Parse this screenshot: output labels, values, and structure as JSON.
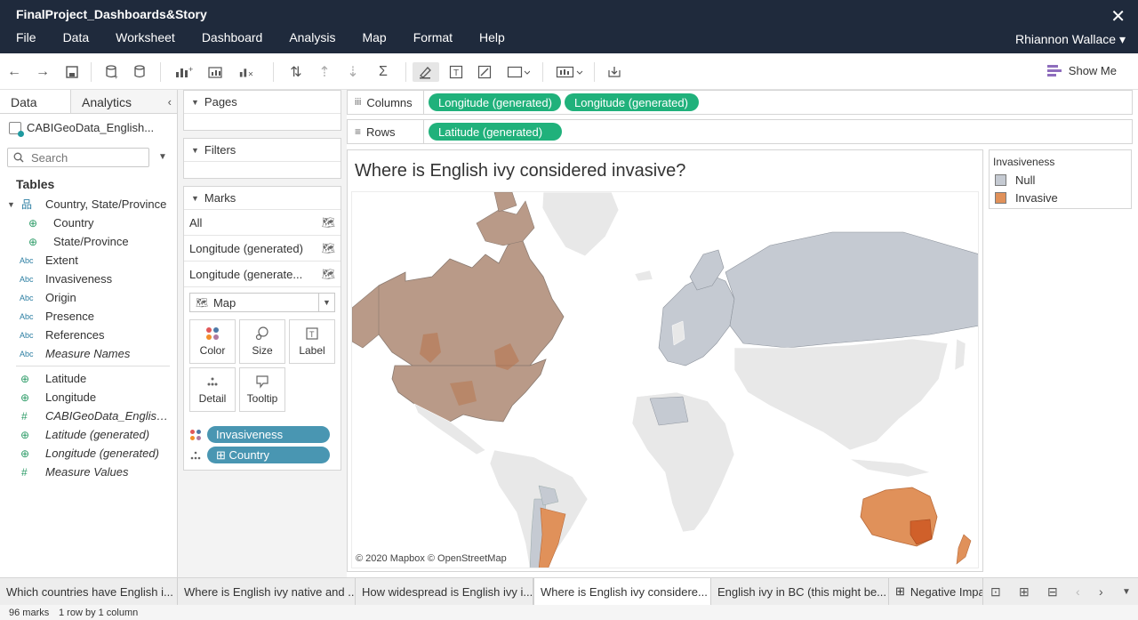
{
  "window": {
    "title": "FinalProject_Dashboards&Story",
    "close_glyph": "✕",
    "menus": [
      "File",
      "Data",
      "Worksheet",
      "Dashboard",
      "Analysis",
      "Map",
      "Format",
      "Help"
    ],
    "user": "Rhiannon Wallace ▾"
  },
  "toolbar": {
    "show_me": "Show Me",
    "icons": [
      "back-arrow-icon",
      "forward-arrow-icon",
      "save-icon",
      "new-data-source-icon",
      "pause-updates-icon",
      "new-worksheet-icon",
      "duplicate-sheet-icon",
      "clear-sheet-icon",
      "swap-rows-columns-icon",
      "sort-ascending-icon",
      "sort-descending-icon",
      "totals-icon",
      "highlight-icon",
      "labels-icon",
      "fix-axes-icon",
      "fit-icon",
      "presentation-icon",
      "share-icon"
    ]
  },
  "datapane": {
    "tab_data": "Data",
    "tab_analytics": "Analytics",
    "collapse_glyph": "‹",
    "datasource": "CABIGeoData_English...",
    "search_placeholder": "Search",
    "tables_label": "Tables",
    "hierarchy": "Country, State/Province",
    "hierarchy_children": [
      "Country",
      "State/Province"
    ],
    "dimensions": [
      "Extent",
      "Invasiveness",
      "Origin",
      "Presence",
      "References",
      "Measure Names"
    ],
    "dimension_type": "Abc",
    "measures": [
      "Latitude",
      "Longitude",
      "CABIGeoData_EnglishI...",
      "Latitude (generated)",
      "Longitude (generated)",
      "Measure Values"
    ]
  },
  "cards": {
    "pages": "Pages",
    "filters": "Filters",
    "marks": "Marks",
    "mark_rows": [
      "All",
      "Longitude (generated)",
      "Longitude (generate..."
    ],
    "mark_type": "Map",
    "mark_buttons": [
      "Color",
      "Size",
      "Label",
      "Detail",
      "Tooltip"
    ],
    "pills": [
      "Invasiveness",
      "⊞ Country"
    ]
  },
  "shelves": {
    "columns_label": "Columns",
    "rows_label": "Rows",
    "columns_pills": [
      "Longitude (generated)",
      "Longitude (generated)"
    ],
    "rows_pills": [
      "Latitude (generated)"
    ]
  },
  "viz": {
    "title": "Where is English ivy considered invasive?",
    "attribution": "© 2020 Mapbox  © OpenStreetMap"
  },
  "legend": {
    "title": "Invasiveness",
    "items": [
      {
        "label": "Null",
        "color": "#c5cad2"
      },
      {
        "label": "Invasive",
        "color": "#e0915a"
      }
    ]
  },
  "colors": {
    "null_country": "#c5cad2",
    "invasive_country": "#e0915a",
    "invasive_state": "#d0602a",
    "north_america_overlay": "#b99a88",
    "no_data_land": "#e8e8e8",
    "titlebar": "#1f2a3c",
    "green_pill": "#20b17b",
    "blue_pill": "#4996b2"
  },
  "sheet_tabs": [
    "Which countries have English i...",
    "Where is English ivy native and ...",
    "How widespread is English ivy i...",
    "Where is English ivy considere...",
    "English ivy in BC (this might be...",
    "Negative Impa"
  ],
  "active_tab_index": 3,
  "status": {
    "marks": "96 marks",
    "dims": "1 row by 1 column"
  }
}
